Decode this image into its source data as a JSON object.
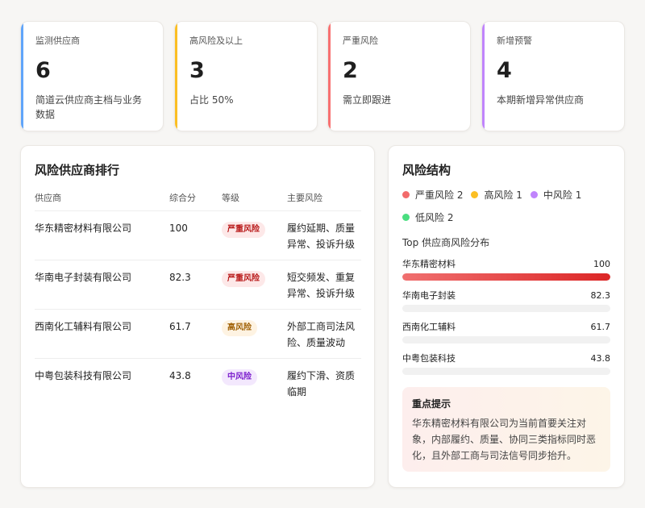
{
  "stats": [
    {
      "label": "监测供应商",
      "value": "6",
      "desc": "简道云供应商主档与业务数据",
      "color": "#60a5fa"
    },
    {
      "label": "高风险及以上",
      "value": "3",
      "desc": "占比 50%",
      "color": "#fbbf24"
    },
    {
      "label": "严重风险",
      "value": "2",
      "desc": "需立即跟进",
      "color": "#f87171"
    },
    {
      "label": "新增预警",
      "value": "4",
      "desc": "本期新增异常供应商",
      "color": "#c084fc"
    }
  ],
  "ranking": {
    "title": "风险供应商排行",
    "headers": {
      "supplier": "供应商",
      "score": "综合分",
      "level": "等级",
      "risk": "主要风险"
    },
    "rows": [
      {
        "supplier": "华东精密材料有限公司",
        "score": "100",
        "level": "严重风险",
        "level_key": "severe",
        "risk": "履约延期、质量异常、投诉升级"
      },
      {
        "supplier": "华南电子封装有限公司",
        "score": "82.3",
        "level": "严重风险",
        "level_key": "severe",
        "risk": "短交频发、重复异常、投诉升级"
      },
      {
        "supplier": "西南化工辅料有限公司",
        "score": "61.7",
        "level": "高风险",
        "level_key": "high",
        "risk": "外部工商司法风险、质量波动"
      },
      {
        "supplier": "中粤包装科技有限公司",
        "score": "43.8",
        "level": "中风险",
        "level_key": "medium",
        "risk": "履约下滑、资质临期"
      }
    ],
    "level_colors": {
      "severe": {
        "bg": "#fde8e8",
        "fg": "#b91c1c"
      },
      "high": {
        "bg": "#fef3e2",
        "fg": "#a16207"
      },
      "medium": {
        "bg": "#f3e8fd",
        "fg": "#7e22ce"
      }
    }
  },
  "structure": {
    "title": "风险结构",
    "legend": [
      {
        "label": "严重风险 2",
        "color": "#f26b6b"
      },
      {
        "label": "高风险 1",
        "color": "#fbbf24"
      },
      {
        "label": "中风险 1",
        "color": "#c084fc"
      },
      {
        "label": "低风险 2",
        "color": "#4ade80"
      }
    ],
    "dist_title": "Top 供应商风险分布",
    "dist": [
      {
        "name": "华东精密材料",
        "value": "100",
        "pct": 100
      },
      {
        "name": "华南电子封装",
        "value": "82.3",
        "pct": 0
      },
      {
        "name": "西南化工辅料",
        "value": "61.7",
        "pct": 0
      },
      {
        "name": "中粤包装科技",
        "value": "43.8",
        "pct": 0
      }
    ],
    "tip": {
      "title": "重点提示",
      "text": "华东精密材料有限公司为当前首要关注对象，内部履约、质量、协同三类指标同时恶化，且外部工商与司法信号同步抬升。"
    }
  }
}
